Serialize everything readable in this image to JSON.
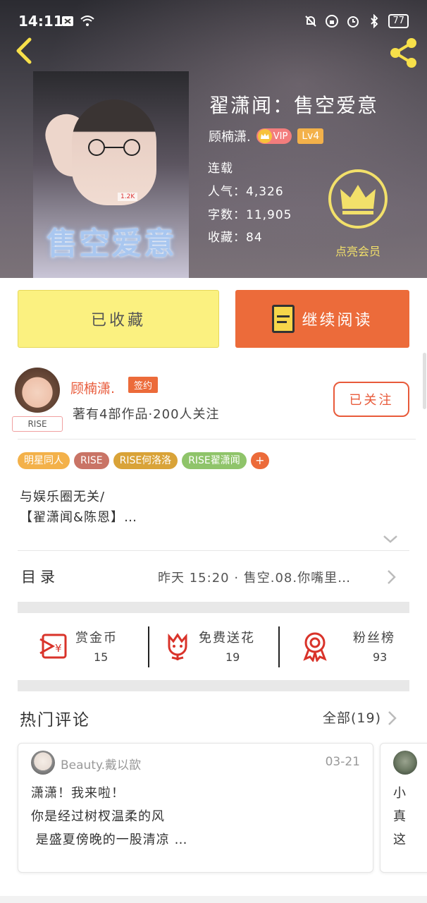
{
  "status_bar": {
    "time": "14:11",
    "battery": "77"
  },
  "book": {
    "title": "翟潇闻：售空爱意",
    "author": "顾楠潇.",
    "vip_label": "VIP",
    "level": "Lv4",
    "status": "连载",
    "popularity_label": "人气：4,326",
    "word_count_label": "字数：11,905",
    "favorites_label": "收藏：84",
    "cover_title": "售空爱意",
    "cover_caption": "1.2K",
    "member_label": "点亮会员"
  },
  "actions": {
    "favorite_label": "已收藏",
    "read_label": "继续阅读"
  },
  "author": {
    "avatar_tag": "RISE",
    "name": "顾楠潇.",
    "badge": "签约",
    "description": "著有4部作品·200人关注",
    "follow_label": "已关注"
  },
  "tags": [
    {
      "label": "明星同人",
      "color": "#f3b14a"
    },
    {
      "label": "RISE",
      "color": "#c97466"
    },
    {
      "label": "RISE何洛洛",
      "color": "#d9a338"
    },
    {
      "label": "RISE翟潇闻",
      "color": "#8fc46a"
    }
  ],
  "synopsis": {
    "line1": "与娱乐圈无关/",
    "line2": "【翟潇闻&陈恩】…"
  },
  "toc": {
    "label": "目录",
    "latest": "昨天 15:20 · 售空.08.你嘴里…"
  },
  "gifts": [
    {
      "label": "赏金币",
      "count": "15"
    },
    {
      "label": "免费送花",
      "count": "19"
    },
    {
      "label": "粉丝榜",
      "count": "93"
    }
  ],
  "comments_section": {
    "title": "热门评论",
    "all_label": "全部(19)"
  },
  "comments": [
    {
      "user": "Beauty.戴以歆",
      "date": "03-21",
      "text": "潇潇！我来啦！\n你是经过树杈温柔的风\n 是盛夏傍晚的一股清凉 …"
    },
    {
      "user": "",
      "date": "",
      "text": "小\n真\n这"
    }
  ],
  "colors": {
    "accent": "#ec6b3a",
    "favorite_bg": "#fbf180",
    "member_gold": "#f2e06a"
  }
}
